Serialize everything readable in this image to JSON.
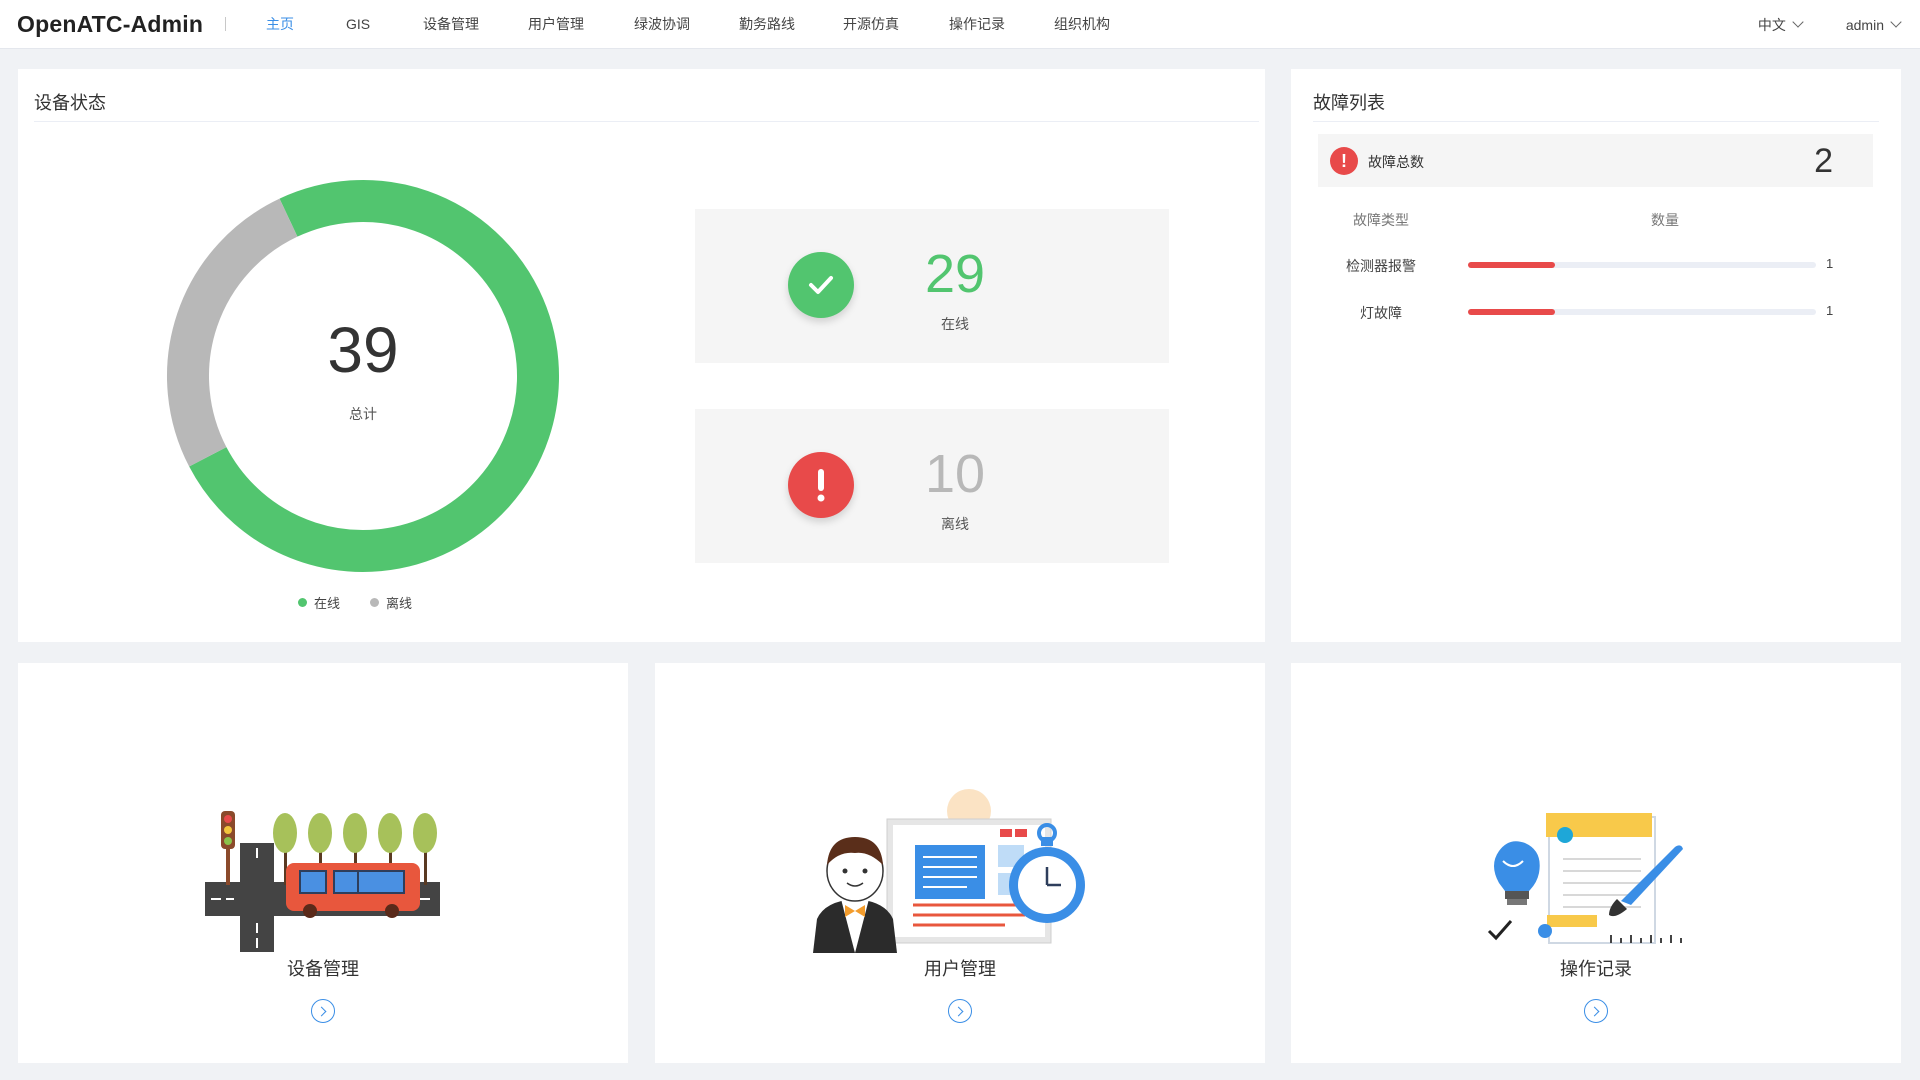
{
  "app": {
    "brand": "OpenATC-Admin"
  },
  "nav": {
    "items": [
      {
        "label": "主页",
        "active": true
      },
      {
        "label": "GIS",
        "active": false
      },
      {
        "label": "设备管理",
        "active": false
      },
      {
        "label": "用户管理",
        "active": false
      },
      {
        "label": "绿波协调",
        "active": false
      },
      {
        "label": "勤务路线",
        "active": false
      },
      {
        "label": "开源仿真",
        "active": false
      },
      {
        "label": "操作记录",
        "active": false
      },
      {
        "label": "组织机构",
        "active": false
      }
    ]
  },
  "header": {
    "language": "中文",
    "user": "admin"
  },
  "device_status": {
    "title": "设备状态",
    "total": "39",
    "total_label": "总计",
    "online": {
      "value": 29,
      "label": "在线",
      "color": "#52c56f"
    },
    "offline": {
      "value": 10,
      "label": "离线",
      "color": "#b8b8b8"
    },
    "online_display": "29",
    "offline_display": "10",
    "legend": [
      {
        "label": "在线",
        "color": "#52c56f"
      },
      {
        "label": "离线",
        "color": "#b8b8b8"
      }
    ]
  },
  "fault_list": {
    "title": "故障列表",
    "total_label": "故障总数",
    "total": "2",
    "headers": {
      "type": "故障类型",
      "count": "数量"
    },
    "rows": [
      {
        "type": "检测器报警",
        "count": "1",
        "ratio": 0.25
      },
      {
        "type": "灯故障",
        "count": "1",
        "ratio": 0.25
      }
    ],
    "bar_color": "#e84a4a"
  },
  "entries": [
    {
      "label": "设备管理",
      "icon": "device-management-illustration"
    },
    {
      "label": "用户管理",
      "icon": "user-management-illustration"
    },
    {
      "label": "操作记录",
      "icon": "operation-log-illustration"
    }
  ],
  "colors": {
    "accent": "#3a8ee6",
    "success": "#52c56f",
    "danger": "#e84a4a",
    "muted": "#b8b8b8"
  }
}
